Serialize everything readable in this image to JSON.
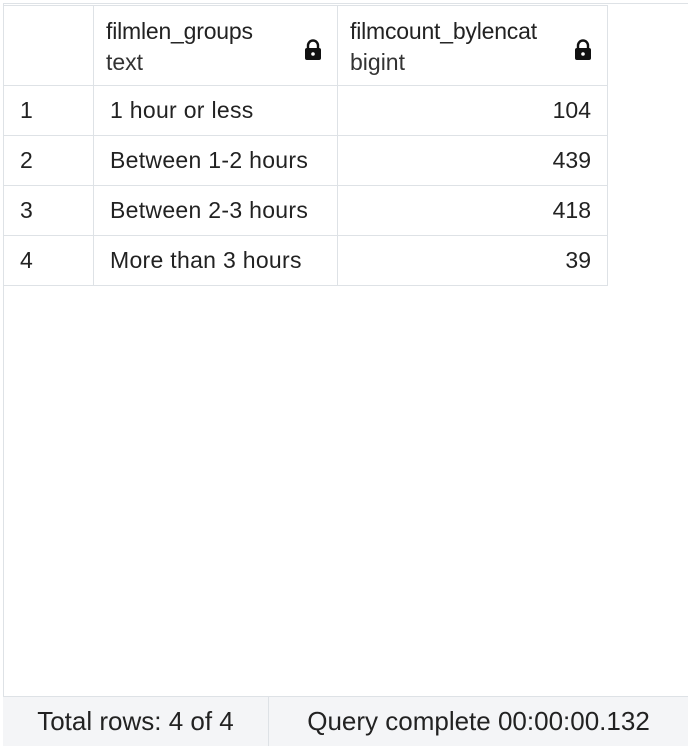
{
  "columns": [
    {
      "name": "filmlen_groups",
      "type": "text",
      "icon": "lock-icon"
    },
    {
      "name": "filmcount_bylencat",
      "type": "bigint",
      "icon": "lock-icon"
    }
  ],
  "rows": [
    {
      "num": "1",
      "filmlen_groups": "1 hour or less",
      "filmcount_bylencat": "104"
    },
    {
      "num": "2",
      "filmlen_groups": "Between 1-2 hours",
      "filmcount_bylencat": "439"
    },
    {
      "num": "3",
      "filmlen_groups": "Between 2-3 hours",
      "filmcount_bylencat": "418"
    },
    {
      "num": "4",
      "filmlen_groups": "More than 3 hours",
      "filmcount_bylencat": "39"
    }
  ],
  "status": {
    "total_rows": "Total rows: 4 of 4",
    "query": "Query complete 00:00:00.132"
  },
  "colors": {
    "border": "#dee2e6",
    "statusbar_bg": "#f4f5f7",
    "text": "#222222"
  }
}
